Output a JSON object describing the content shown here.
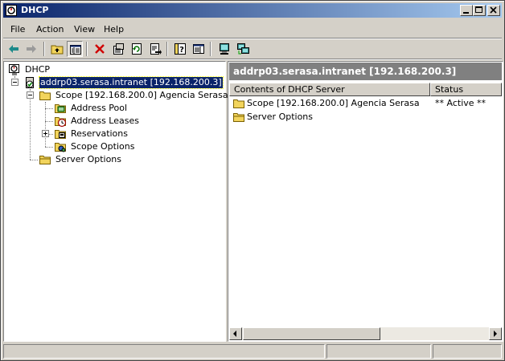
{
  "window": {
    "title": "DHCP"
  },
  "menu": [
    {
      "label": "File"
    },
    {
      "label": "Action"
    },
    {
      "label": "View"
    },
    {
      "label": "Help"
    }
  ],
  "toolbar": [
    "back-icon",
    "forward-icon",
    "up-one-level-icon",
    "show-hide-console-tree-icon",
    "delete-icon",
    "properties-icon",
    "refresh-icon",
    "export-list-icon",
    "help-icon",
    "show-hide-action-pane-icon",
    "server-monitor-icon",
    "server-network-icon"
  ],
  "tree": {
    "root": "DHCP",
    "server": "addrp03.serasa.intranet [192.168.200.3]",
    "scope": "Scope [192.168.200.0] Agencia Serasa",
    "scope_children": [
      "Address Pool",
      "Address Leases",
      "Reservations",
      "Scope Options"
    ],
    "server_options": "Server Options"
  },
  "content": {
    "header": "addrp03.serasa.intranet [192.168.200.3]",
    "columns": [
      "Contents of DHCP Server",
      "Status"
    ],
    "rows": [
      {
        "name": "Scope [192.168.200.0] Agencia Serasa",
        "status": "** Active **"
      },
      {
        "name": "Server Options",
        "status": ""
      }
    ]
  },
  "colors": {
    "title_start": "#0a246a",
    "title_end": "#a6caf0",
    "selection": "#0a246a"
  }
}
